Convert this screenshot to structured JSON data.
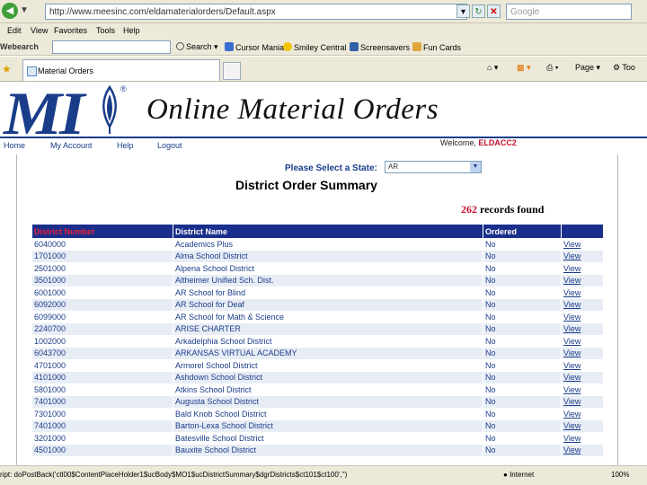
{
  "browser": {
    "address": "http://www.meesinc.com/eldamaterialorders/Default.aspx",
    "search_placeholder": "Google",
    "menu": [
      "Edit",
      "View",
      "Favorites",
      "Tools",
      "Help"
    ],
    "toolbar": {
      "brand": "Webearch",
      "search_btn": "Search",
      "items": [
        "Cursor Mania",
        "Smiley Central",
        "Screensavers",
        "Fun Cards"
      ]
    },
    "tab_title": "Material Orders",
    "tab_right": [
      "Page",
      "Too"
    ]
  },
  "site": {
    "logo_text": "MI",
    "logo_reg": "®",
    "title": "Online Material Orders",
    "nav": [
      "Home",
      "My Account",
      "Help",
      "Logout"
    ],
    "welcome_prefix": "Welcome,",
    "welcome_user": "ELDACC2"
  },
  "state": {
    "label": "Please Select a State:",
    "value": "AR"
  },
  "summary": {
    "title": "District Order Summary",
    "records_count": "262",
    "records_text": "records found",
    "headers": [
      "District Number",
      "District Name",
      "Ordered",
      ""
    ],
    "rows": [
      [
        "6040000",
        "Academics Plus",
        "No",
        "View"
      ],
      [
        "1701000",
        "Alma School District",
        "No",
        "View"
      ],
      [
        "2501000",
        "Alpena School District",
        "No",
        "View"
      ],
      [
        "3501000",
        "Altheimer Unified Sch. Dist.",
        "No",
        "View"
      ],
      [
        "6001000",
        "AR School for Blind",
        "No",
        "View"
      ],
      [
        "6092000",
        "AR School for Deaf",
        "No",
        "View"
      ],
      [
        "6099000",
        "AR School for Math & Science",
        "No",
        "View"
      ],
      [
        "2240700",
        "ARISE CHARTER",
        "No",
        "View"
      ],
      [
        "1002000",
        "Arkadelphia School District",
        "No",
        "View"
      ],
      [
        "6043700",
        "ARKANSAS VIRTUAL ACADEMY",
        "No",
        "View"
      ],
      [
        "4701000",
        "Armorel School District",
        "No",
        "View"
      ],
      [
        "4101000",
        "Ashdown School District",
        "No",
        "View"
      ],
      [
        "5801000",
        "Atkins School District",
        "No",
        "View"
      ],
      [
        "7401000",
        "Augusta School District",
        "No",
        "View"
      ],
      [
        "7301000",
        "Bald Knob School District",
        "No",
        "View"
      ],
      [
        "7401000",
        "Barton-Lexa School District",
        "No",
        "View"
      ],
      [
        "3201000",
        "Batesville School District",
        "No",
        "View"
      ],
      [
        "4501000",
        "Bauxite School District",
        "No",
        "View"
      ]
    ]
  },
  "status": {
    "text": "ript: doPostBack('ctl00$ContentPlaceHolder1$ucBody$MO1$ucDistrictSummary$dgrDistricts$ct101$ct100','')",
    "zone": "Internet",
    "zoom": "100%"
  }
}
